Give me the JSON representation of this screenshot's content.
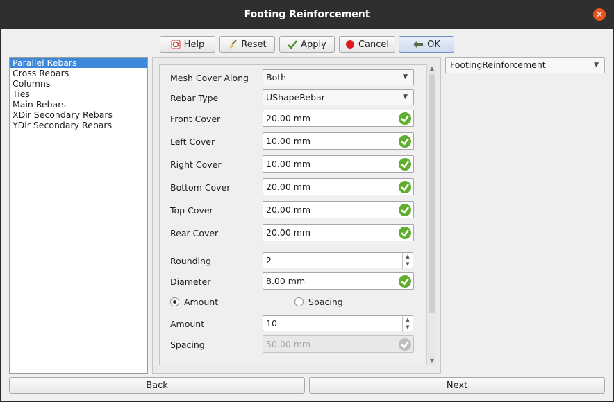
{
  "window": {
    "title": "Footing Reinforcement"
  },
  "toolbar": {
    "help_label": "Help",
    "reset_label": "Reset",
    "apply_label": "Apply",
    "cancel_label": "Cancel",
    "ok_label": "OK"
  },
  "sidebar": {
    "items": [
      {
        "label": "Parallel Rebars",
        "selected": true
      },
      {
        "label": "Cross Rebars",
        "selected": false
      },
      {
        "label": "Columns",
        "selected": false
      },
      {
        "label": "Ties",
        "selected": false
      },
      {
        "label": "Main Rebars",
        "selected": false
      },
      {
        "label": "XDir Secondary Rebars",
        "selected": false
      },
      {
        "label": "YDir Secondary Rebars",
        "selected": false
      }
    ]
  },
  "form": {
    "mesh_cover_along": {
      "label": "Mesh Cover Along",
      "value": "Both"
    },
    "rebar_type": {
      "label": "Rebar Type",
      "value": "UShapeRebar"
    },
    "front_cover": {
      "label": "Front Cover",
      "value": "20.00 mm"
    },
    "left_cover": {
      "label": "Left Cover",
      "value": "10.00 mm"
    },
    "right_cover": {
      "label": "Right Cover",
      "value": "10.00 mm"
    },
    "bottom_cover": {
      "label": "Bottom Cover",
      "value": "20.00 mm"
    },
    "top_cover": {
      "label": "Top Cover",
      "value": "20.00 mm"
    },
    "rear_cover": {
      "label": "Rear Cover",
      "value": "20.00 mm"
    },
    "rounding": {
      "label": "Rounding",
      "value": "2"
    },
    "diameter": {
      "label": "Diameter",
      "value": "8.00 mm"
    },
    "mode": {
      "amount_label": "Amount",
      "spacing_label": "Spacing",
      "selected": "Amount"
    },
    "amount": {
      "label": "Amount",
      "value": "10"
    },
    "spacing": {
      "label": "Spacing",
      "value": "50.00 mm",
      "enabled": false
    }
  },
  "object_select": {
    "value": "FootingReinforcement"
  },
  "footer": {
    "back_label": "Back",
    "next_label": "Next"
  },
  "colors": {
    "accent": "#3d88d8",
    "close": "#e95420",
    "check": "#5fae2e"
  }
}
